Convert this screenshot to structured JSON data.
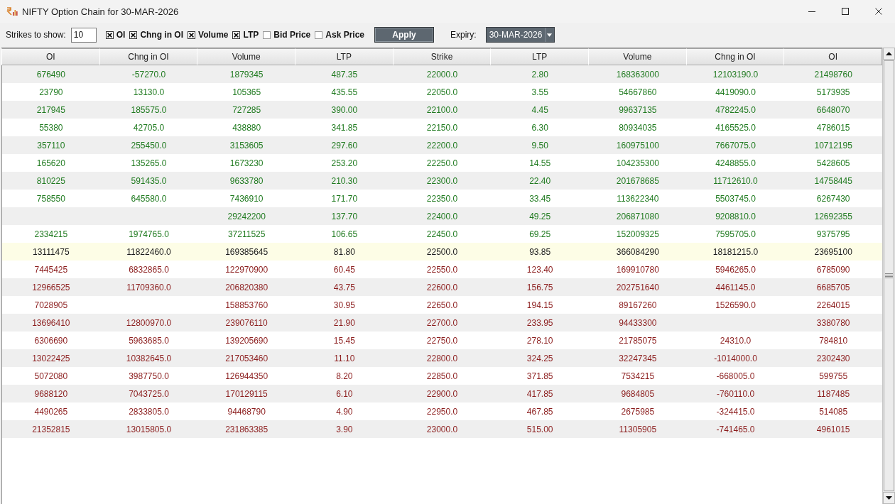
{
  "window": {
    "title": "NIFTY Option Chain for 30-MAR-2026"
  },
  "toolbar": {
    "strikes_label": "Strikes to show:",
    "strikes_value": "10",
    "options": [
      {
        "label": "OI",
        "checked": true
      },
      {
        "label": "Chng in OI",
        "checked": true
      },
      {
        "label": "Volume",
        "checked": true
      },
      {
        "label": "LTP",
        "checked": true
      },
      {
        "label": "Bid Price",
        "checked": false
      },
      {
        "label": "Ask Price",
        "checked": false
      }
    ],
    "apply_button": "Apply",
    "expiry_label": "Expiry:",
    "expiry_value": "30-MAR-2026"
  },
  "table": {
    "columns": [
      "OI",
      "Chng in OI",
      "Volume",
      "LTP",
      "Strike",
      "LTP",
      "Volume",
      "Chng in OI",
      "OI"
    ],
    "rows": [
      {
        "color": "#1f7a1f",
        "highlighted": false,
        "call": {
          "oi": "676490",
          "chng_in_oi": "-57270.0",
          "volume": "1879345",
          "ltp": "487.35"
        },
        "strike": "22000.0",
        "put": {
          "ltp": "2.80",
          "volume": "168363000",
          "chng_in_oi": "12103190.0",
          "oi": "21498760"
        }
      },
      {
        "color": "#1f7a1f",
        "highlighted": false,
        "call": {
          "oi": "23790",
          "chng_in_oi": "13130.0",
          "volume": "105365",
          "ltp": "435.55"
        },
        "strike": "22050.0",
        "put": {
          "ltp": "3.55",
          "volume": "54667860",
          "chng_in_oi": "4419090.0",
          "oi": "5173935"
        }
      },
      {
        "color": "#1f7a1f",
        "highlighted": false,
        "call": {
          "oi": "217945",
          "chng_in_oi": "185575.0",
          "volume": "727285",
          "ltp": "390.00"
        },
        "strike": "22100.0",
        "put": {
          "ltp": "4.45",
          "volume": "99637135",
          "chng_in_oi": "4782245.0",
          "oi": "6648070"
        }
      },
      {
        "color": "#1f7a1f",
        "highlighted": false,
        "call": {
          "oi": "55380",
          "chng_in_oi": "42705.0",
          "volume": "438880",
          "ltp": "341.85"
        },
        "strike": "22150.0",
        "put": {
          "ltp": "6.30",
          "volume": "80934035",
          "chng_in_oi": "4165525.0",
          "oi": "4786015"
        }
      },
      {
        "color": "#1f7a1f",
        "highlighted": false,
        "call": {
          "oi": "357110",
          "chng_in_oi": "255450.0",
          "volume": "3153605",
          "ltp": "297.60"
        },
        "strike": "22200.0",
        "put": {
          "ltp": "9.50",
          "volume": "160975100",
          "chng_in_oi": "7667075.0",
          "oi": "10712195"
        }
      },
      {
        "color": "#1f7a1f",
        "highlighted": false,
        "call": {
          "oi": "165620",
          "chng_in_oi": "135265.0",
          "volume": "1673230",
          "ltp": "253.20"
        },
        "strike": "22250.0",
        "put": {
          "ltp": "14.55",
          "volume": "104235300",
          "chng_in_oi": "4248855.0",
          "oi": "5428605"
        }
      },
      {
        "color": "#1f7a1f",
        "highlighted": false,
        "call": {
          "oi": "810225",
          "chng_in_oi": "591435.0",
          "volume": "9633780",
          "ltp": "210.30"
        },
        "strike": "22300.0",
        "put": {
          "ltp": "22.40",
          "volume": "201678685",
          "chng_in_oi": "11712610.0",
          "oi": "14758445"
        }
      },
      {
        "color": "#1f7a1f",
        "highlighted": false,
        "call": {
          "oi": "758550",
          "chng_in_oi": "645580.0",
          "volume": "7436910",
          "ltp": "171.70"
        },
        "strike": "22350.0",
        "put": {
          "ltp": "33.45",
          "volume": "113622340",
          "chng_in_oi": "5503745.0",
          "oi": "6267430"
        }
      },
      {
        "color": "#1f7a1f",
        "highlighted": false,
        "call": {
          "volume": "29242200",
          "ltp": "137.70"
        },
        "strike": "22400.0",
        "put": {
          "ltp": "49.25",
          "volume": "206871080",
          "chng_in_oi": "9208810.0",
          "oi": "12692355"
        }
      },
      {
        "color": "#1f7a1f",
        "highlighted": false,
        "call": {
          "oi": "2334215",
          "chng_in_oi": "1974765.0",
          "volume": "37211525",
          "ltp": "106.65"
        },
        "strike": "22450.0",
        "put": {
          "ltp": "69.25",
          "volume": "152009325",
          "chng_in_oi": "7595705.0",
          "oi": "9375795"
        }
      },
      {
        "color": "#1a1a1a",
        "highlighted": true,
        "call": {
          "oi": "13111475",
          "chng_in_oi": "11822460.0",
          "volume": "169385645",
          "ltp": "81.80"
        },
        "strike": "22500.0",
        "put": {
          "ltp": "93.85",
          "volume": "366084290",
          "chng_in_oi": "18181215.0",
          "oi": "23695100"
        }
      },
      {
        "color": "#8b1c1c",
        "highlighted": false,
        "call": {
          "oi": "7445425",
          "chng_in_oi": "6832865.0",
          "volume": "122970900",
          "ltp": "60.45"
        },
        "strike": "22550.0",
        "put": {
          "ltp": "123.40",
          "volume": "169910780",
          "chng_in_oi": "5946265.0",
          "oi": "6785090"
        }
      },
      {
        "color": "#8b1c1c",
        "highlighted": false,
        "call": {
          "oi": "12966525",
          "chng_in_oi": "11709360.0",
          "volume": "206820380",
          "ltp": "43.75"
        },
        "strike": "22600.0",
        "put": {
          "ltp": "156.75",
          "volume": "202751640",
          "chng_in_oi": "4461145.0",
          "oi": "6685705"
        }
      },
      {
        "color": "#8b1c1c",
        "highlighted": false,
        "call": {
          "oi": "7028905",
          "volume": "158853760",
          "ltp": "30.95"
        },
        "strike": "22650.0",
        "put": {
          "ltp": "194.15",
          "volume": "89167260",
          "chng_in_oi": "1526590.0",
          "oi": "2264015"
        }
      },
      {
        "color": "#8b1c1c",
        "highlighted": false,
        "call": {
          "oi": "13696410",
          "chng_in_oi": "12800970.0",
          "volume": "239076110",
          "ltp": "21.90"
        },
        "strike": "22700.0",
        "put": {
          "ltp": "233.95",
          "volume": "94433300",
          "oi": "3380780"
        }
      },
      {
        "color": "#8b1c1c",
        "highlighted": false,
        "call": {
          "oi": "6306690",
          "chng_in_oi": "5963685.0",
          "volume": "139205690",
          "ltp": "15.45"
        },
        "strike": "22750.0",
        "put": {
          "ltp": "278.10",
          "volume": "21785075",
          "chng_in_oi": "24310.0",
          "oi": "784810"
        }
      },
      {
        "color": "#8b1c1c",
        "highlighted": false,
        "call": {
          "oi": "13022425",
          "chng_in_oi": "10382645.0",
          "volume": "217053460",
          "ltp": "11.10"
        },
        "strike": "22800.0",
        "put": {
          "ltp": "324.25",
          "volume": "32247345",
          "chng_in_oi": "-1014000.0",
          "oi": "2302430"
        }
      },
      {
        "color": "#8b1c1c",
        "highlighted": false,
        "call": {
          "oi": "5072080",
          "chng_in_oi": "3987750.0",
          "volume": "126944350",
          "ltp": "8.20"
        },
        "strike": "22850.0",
        "put": {
          "ltp": "371.85",
          "volume": "7534215",
          "chng_in_oi": "-668005.0",
          "oi": "599755"
        }
      },
      {
        "color": "#8b1c1c",
        "highlighted": false,
        "call": {
          "oi": "9688120",
          "chng_in_oi": "7043725.0",
          "volume": "170129115",
          "ltp": "6.10"
        },
        "strike": "22900.0",
        "put": {
          "ltp": "417.85",
          "volume": "9684805",
          "chng_in_oi": "-760110.0",
          "oi": "1187485"
        }
      },
      {
        "color": "#8b1c1c",
        "highlighted": false,
        "call": {
          "oi": "4490265",
          "chng_in_oi": "2833805.0",
          "volume": "94468790",
          "ltp": "4.90"
        },
        "strike": "22950.0",
        "put": {
          "ltp": "467.85",
          "volume": "2675985",
          "chng_in_oi": "-324415.0",
          "oi": "514085"
        }
      },
      {
        "color": "#8b1c1c",
        "highlighted": false,
        "call": {
          "oi": "21352815",
          "chng_in_oi": "13015805.0",
          "volume": "231863385",
          "ltp": "3.90"
        },
        "strike": "23000.0",
        "put": {
          "ltp": "515.00",
          "volume": "11305905",
          "chng_in_oi": "-741465.0",
          "oi": "4961015"
        }
      }
    ]
  }
}
